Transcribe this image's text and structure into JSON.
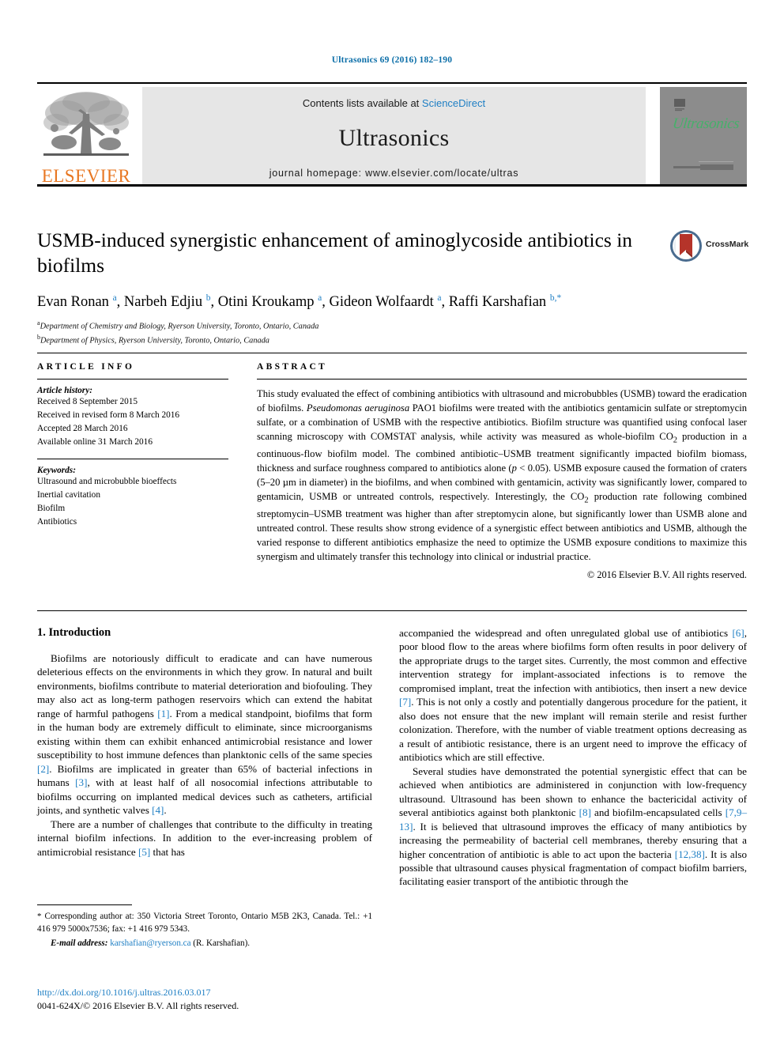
{
  "running_head": "Ultrasonics 69 (2016) 182–190",
  "masthead": {
    "contents_prefix": "Contents lists available at ",
    "sciencedirect": "ScienceDirect",
    "journal_name": "Ultrasonics",
    "homepage": "journal homepage: www.elsevier.com/locate/ultras",
    "publisher_wordmark": "ELSEVIER",
    "cover_title": "Ultrasonics",
    "accent_link": "#1f7fc4",
    "publisher_color": "#e87722",
    "cover_title_color": "#46b06a"
  },
  "article": {
    "title": "USMB-induced synergistic enhancement of aminoglycoside antibiotics in biofilms",
    "crossmark_label": "CrossMark",
    "authors_html": "Evan Ronan <sup>a</sup>, Narbeh Edjiu <sup>b</sup>, Otini Kroukamp <sup>a</sup>, Gideon Wolfaardt <sup>a</sup>, Raffi Karshafian <sup>b,*</sup>",
    "affiliations": [
      {
        "marker": "a",
        "text": "Department of Chemistry and Biology, Ryerson University, Toronto, Ontario, Canada"
      },
      {
        "marker": "b",
        "text": "Department of Physics, Ryerson University, Toronto, Ontario, Canada"
      }
    ]
  },
  "info": {
    "heading": "ARTICLE INFO",
    "history_label": "Article history:",
    "history": [
      "Received 8 September 2015",
      "Received in revised form 8 March 2016",
      "Accepted 28 March 2016",
      "Available online 31 March 2016"
    ],
    "keywords_label": "Keywords:",
    "keywords": [
      "Ultrasound and microbubble bioeffects",
      "Inertial cavitation",
      "Biofilm",
      "Antibiotics"
    ]
  },
  "abstract": {
    "heading": "ABSTRACT",
    "body_html": "This study evaluated the effect of combining antibiotics with ultrasound and microbubbles (USMB) toward the eradication of biofilms. <i>Pseudomonas aeruginosa</i> PAO1 biofilms were treated with the antibiotics gentamicin sulfate or streptomycin sulfate, or a combination of USMB with the respective antibiotics. Biofilm structure was quantified using confocal laser scanning microscopy with COMSTAT analysis, while activity was measured as whole-biofilm CO<sub>2</sub> production in a continuous-flow biofilm model. The combined antibiotic–USMB treatment significantly impacted biofilm biomass, thickness and surface roughness compared to antibiotics alone (<i>p</i> &lt; 0.05). USMB exposure caused the formation of craters (5–20 µm in diameter) in the biofilms, and when combined with gentamicin, activity was significantly lower, compared to gentamicin, USMB or untreated controls, respectively. Interestingly, the CO<sub>2</sub> production rate following combined streptomycin–USMB treatment was higher than after streptomycin alone, but significantly lower than USMB alone and untreated control. These results show strong evidence of a synergistic effect between antibiotics and USMB, although the varied response to different antibiotics emphasize the need to optimize the USMB exposure conditions to maximize this synergism and ultimately transfer this technology into clinical or industrial practice.",
    "copyright": "© 2016 Elsevier B.V. All rights reserved."
  },
  "body": {
    "section_title": "1. Introduction",
    "left_paragraphs_html": [
      "Biofilms are notoriously difficult to eradicate and can have numerous deleterious effects on the environments in which they grow. In natural and built environments, biofilms contribute to material deterioration and biofouling. They may also act as long-term pathogen reservoirs which can extend the habitat range of harmful pathogens <span class=\"ref\">[1]</span>. From a medical standpoint, biofilms that form in the human body are extremely difficult to eliminate, since microorganisms existing within them can exhibit enhanced antimicrobial resistance and lower susceptibility to host immune defences than planktonic cells of the same species <span class=\"ref\">[2]</span>. Biofilms are implicated in greater than 65% of bacterial infections in humans <span class=\"ref\">[3]</span>, with at least half of all nosocomial infections attributable to biofilms occurring on implanted medical devices such as catheters, artificial joints, and synthetic valves <span class=\"ref\">[4]</span>.",
      "There are a number of challenges that contribute to the difficulty in treating internal biofilm infections. In addition to the ever-increasing problem of antimicrobial resistance <span class=\"ref\">[5]</span> that has"
    ],
    "right_paragraphs_html": [
      "accompanied the widespread and often unregulated global use of antibiotics <span class=\"ref\">[6]</span>, poor blood flow to the areas where biofilms form often results in poor delivery of the appropriate drugs to the target sites. Currently, the most common and effective intervention strategy for implant-associated infections is to remove the compromised implant, treat the infection with antibiotics, then insert a new device <span class=\"ref\">[7]</span>. This is not only a costly and potentially dangerous procedure for the patient, it also does not ensure that the new implant will remain sterile and resist further colonization. Therefore, with the number of viable treatment options decreasing as a result of antibiotic resistance, there is an urgent need to improve the efficacy of antibiotics which are still effective.",
      "Several studies have demonstrated the potential synergistic effect that can be achieved when antibiotics are administered in conjunction with low-frequency ultrasound. Ultrasound has been shown to enhance the bactericidal activity of several antibiotics against both planktonic <span class=\"ref\">[8]</span> and biofilm-encapsulated cells <span class=\"ref\">[7,9–13]</span>. It is believed that ultrasound improves the efficacy of many antibiotics by increasing the permeability of bacterial cell membranes, thereby ensuring that a higher concentration of antibiotic is able to act upon the bacteria <span class=\"ref\">[12,38]</span>. It is also possible that ultrasound causes physical fragmentation of compact biofilm barriers, facilitating easier transport of the antibiotic through the"
    ]
  },
  "footnotes": {
    "corresponding_html": "<span class=\"star\">*</span> Corresponding author at: 350 Victoria Street Toronto, Ontario M5B 2K3, Canada. Tel.: +1 416 979 5000x7536; fax: +1 416 979 5343.",
    "email_label": "E-mail address:",
    "email": "karshafian@ryerson.ca",
    "email_owner": "(R. Karshafian).",
    "doi": "http://dx.doi.org/10.1016/j.ultras.2016.03.017",
    "issn_line": "0041-624X/© 2016 Elsevier B.V. All rights reserved."
  }
}
